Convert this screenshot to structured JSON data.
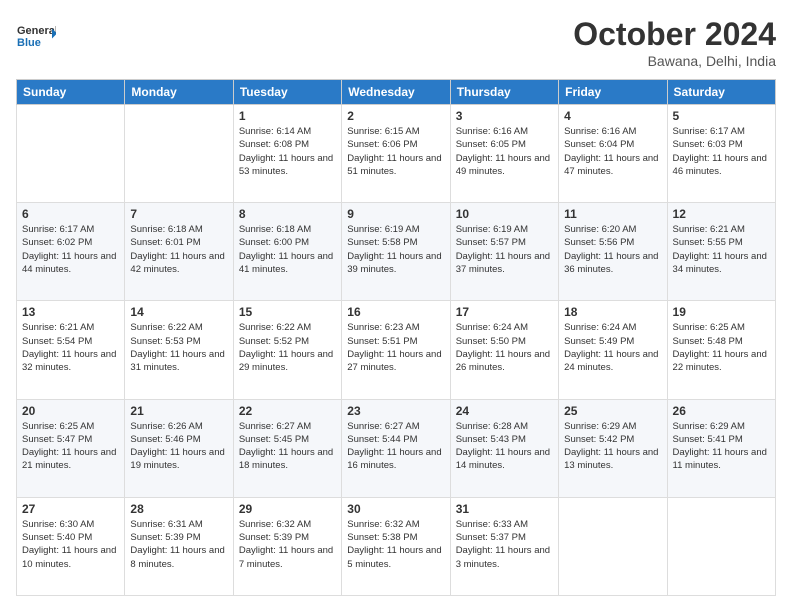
{
  "logo": {
    "line1": "General",
    "line2": "Blue"
  },
  "title": "October 2024",
  "location": "Bawana, Delhi, India",
  "days": [
    "Sunday",
    "Monday",
    "Tuesday",
    "Wednesday",
    "Thursday",
    "Friday",
    "Saturday"
  ],
  "weeks": [
    [
      {
        "day": "",
        "sunrise": "",
        "sunset": "",
        "daylight": ""
      },
      {
        "day": "",
        "sunrise": "",
        "sunset": "",
        "daylight": ""
      },
      {
        "day": "1",
        "sunrise": "Sunrise: 6:14 AM",
        "sunset": "Sunset: 6:08 PM",
        "daylight": "Daylight: 11 hours and 53 minutes."
      },
      {
        "day": "2",
        "sunrise": "Sunrise: 6:15 AM",
        "sunset": "Sunset: 6:06 PM",
        "daylight": "Daylight: 11 hours and 51 minutes."
      },
      {
        "day": "3",
        "sunrise": "Sunrise: 6:16 AM",
        "sunset": "Sunset: 6:05 PM",
        "daylight": "Daylight: 11 hours and 49 minutes."
      },
      {
        "day": "4",
        "sunrise": "Sunrise: 6:16 AM",
        "sunset": "Sunset: 6:04 PM",
        "daylight": "Daylight: 11 hours and 47 minutes."
      },
      {
        "day": "5",
        "sunrise": "Sunrise: 6:17 AM",
        "sunset": "Sunset: 6:03 PM",
        "daylight": "Daylight: 11 hours and 46 minutes."
      }
    ],
    [
      {
        "day": "6",
        "sunrise": "Sunrise: 6:17 AM",
        "sunset": "Sunset: 6:02 PM",
        "daylight": "Daylight: 11 hours and 44 minutes."
      },
      {
        "day": "7",
        "sunrise": "Sunrise: 6:18 AM",
        "sunset": "Sunset: 6:01 PM",
        "daylight": "Daylight: 11 hours and 42 minutes."
      },
      {
        "day": "8",
        "sunrise": "Sunrise: 6:18 AM",
        "sunset": "Sunset: 6:00 PM",
        "daylight": "Daylight: 11 hours and 41 minutes."
      },
      {
        "day": "9",
        "sunrise": "Sunrise: 6:19 AM",
        "sunset": "Sunset: 5:58 PM",
        "daylight": "Daylight: 11 hours and 39 minutes."
      },
      {
        "day": "10",
        "sunrise": "Sunrise: 6:19 AM",
        "sunset": "Sunset: 5:57 PM",
        "daylight": "Daylight: 11 hours and 37 minutes."
      },
      {
        "day": "11",
        "sunrise": "Sunrise: 6:20 AM",
        "sunset": "Sunset: 5:56 PM",
        "daylight": "Daylight: 11 hours and 36 minutes."
      },
      {
        "day": "12",
        "sunrise": "Sunrise: 6:21 AM",
        "sunset": "Sunset: 5:55 PM",
        "daylight": "Daylight: 11 hours and 34 minutes."
      }
    ],
    [
      {
        "day": "13",
        "sunrise": "Sunrise: 6:21 AM",
        "sunset": "Sunset: 5:54 PM",
        "daylight": "Daylight: 11 hours and 32 minutes."
      },
      {
        "day": "14",
        "sunrise": "Sunrise: 6:22 AM",
        "sunset": "Sunset: 5:53 PM",
        "daylight": "Daylight: 11 hours and 31 minutes."
      },
      {
        "day": "15",
        "sunrise": "Sunrise: 6:22 AM",
        "sunset": "Sunset: 5:52 PM",
        "daylight": "Daylight: 11 hours and 29 minutes."
      },
      {
        "day": "16",
        "sunrise": "Sunrise: 6:23 AM",
        "sunset": "Sunset: 5:51 PM",
        "daylight": "Daylight: 11 hours and 27 minutes."
      },
      {
        "day": "17",
        "sunrise": "Sunrise: 6:24 AM",
        "sunset": "Sunset: 5:50 PM",
        "daylight": "Daylight: 11 hours and 26 minutes."
      },
      {
        "day": "18",
        "sunrise": "Sunrise: 6:24 AM",
        "sunset": "Sunset: 5:49 PM",
        "daylight": "Daylight: 11 hours and 24 minutes."
      },
      {
        "day": "19",
        "sunrise": "Sunrise: 6:25 AM",
        "sunset": "Sunset: 5:48 PM",
        "daylight": "Daylight: 11 hours and 22 minutes."
      }
    ],
    [
      {
        "day": "20",
        "sunrise": "Sunrise: 6:25 AM",
        "sunset": "Sunset: 5:47 PM",
        "daylight": "Daylight: 11 hours and 21 minutes."
      },
      {
        "day": "21",
        "sunrise": "Sunrise: 6:26 AM",
        "sunset": "Sunset: 5:46 PM",
        "daylight": "Daylight: 11 hours and 19 minutes."
      },
      {
        "day": "22",
        "sunrise": "Sunrise: 6:27 AM",
        "sunset": "Sunset: 5:45 PM",
        "daylight": "Daylight: 11 hours and 18 minutes."
      },
      {
        "day": "23",
        "sunrise": "Sunrise: 6:27 AM",
        "sunset": "Sunset: 5:44 PM",
        "daylight": "Daylight: 11 hours and 16 minutes."
      },
      {
        "day": "24",
        "sunrise": "Sunrise: 6:28 AM",
        "sunset": "Sunset: 5:43 PM",
        "daylight": "Daylight: 11 hours and 14 minutes."
      },
      {
        "day": "25",
        "sunrise": "Sunrise: 6:29 AM",
        "sunset": "Sunset: 5:42 PM",
        "daylight": "Daylight: 11 hours and 13 minutes."
      },
      {
        "day": "26",
        "sunrise": "Sunrise: 6:29 AM",
        "sunset": "Sunset: 5:41 PM",
        "daylight": "Daylight: 11 hours and 11 minutes."
      }
    ],
    [
      {
        "day": "27",
        "sunrise": "Sunrise: 6:30 AM",
        "sunset": "Sunset: 5:40 PM",
        "daylight": "Daylight: 11 hours and 10 minutes."
      },
      {
        "day": "28",
        "sunrise": "Sunrise: 6:31 AM",
        "sunset": "Sunset: 5:39 PM",
        "daylight": "Daylight: 11 hours and 8 minutes."
      },
      {
        "day": "29",
        "sunrise": "Sunrise: 6:32 AM",
        "sunset": "Sunset: 5:39 PM",
        "daylight": "Daylight: 11 hours and 7 minutes."
      },
      {
        "day": "30",
        "sunrise": "Sunrise: 6:32 AM",
        "sunset": "Sunset: 5:38 PM",
        "daylight": "Daylight: 11 hours and 5 minutes."
      },
      {
        "day": "31",
        "sunrise": "Sunrise: 6:33 AM",
        "sunset": "Sunset: 5:37 PM",
        "daylight": "Daylight: 11 hours and 3 minutes."
      },
      {
        "day": "",
        "sunrise": "",
        "sunset": "",
        "daylight": ""
      },
      {
        "day": "",
        "sunrise": "",
        "sunset": "",
        "daylight": ""
      }
    ]
  ]
}
